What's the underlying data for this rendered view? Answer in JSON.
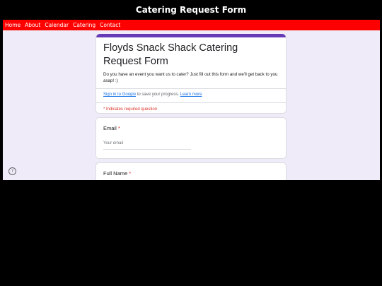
{
  "page": {
    "title": "Catering Request Form"
  },
  "nav": {
    "items": [
      "Home",
      "About",
      "Calendar",
      "Catering",
      "Contact"
    ]
  },
  "form": {
    "title": "Floyds Snack Shack Catering Request Form",
    "description": "Do you have an event you want us to cater? Just fill out this form and we'll get back to you asap! :)",
    "signin": {
      "link": "Sign in to Google",
      "text": " to save your progress. ",
      "learn_more": "Learn more"
    },
    "required_note": "* Indicates required question",
    "questions": [
      {
        "label": "Email",
        "star": "*",
        "placeholder": "Your email"
      },
      {
        "label": "Full Name",
        "star": "*"
      }
    ]
  },
  "colors": {
    "nav_bg": "#ff0000",
    "form_accent": "#673ab7",
    "form_bg": "#f0ebf8",
    "required": "#d93025"
  },
  "icons": {
    "help": "help-circle-icon"
  }
}
